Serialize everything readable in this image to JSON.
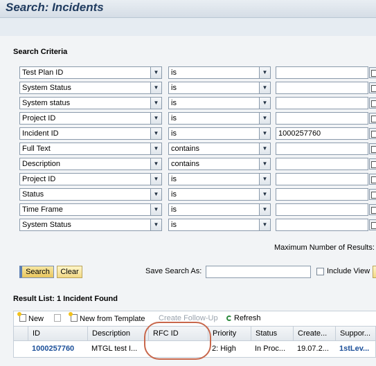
{
  "title": "Search: Incidents",
  "search_criteria": {
    "heading": "Search Criteria",
    "rows": [
      {
        "field": "Test Plan ID",
        "operator": "is",
        "value": ""
      },
      {
        "field": "System Status",
        "operator": "is",
        "value": ""
      },
      {
        "field": "System status",
        "operator": "is",
        "value": ""
      },
      {
        "field": "Project ID",
        "operator": "is",
        "value": ""
      },
      {
        "field": "Incident ID",
        "operator": "is",
        "value": "1000257760"
      },
      {
        "field": "Full Text",
        "operator": "contains",
        "value": ""
      },
      {
        "field": "Description",
        "operator": "contains",
        "value": ""
      },
      {
        "field": "Project ID",
        "operator": "is",
        "value": ""
      },
      {
        "field": "Status",
        "operator": "is",
        "value": ""
      },
      {
        "field": "Time Frame",
        "operator": "is",
        "value": ""
      },
      {
        "field": "System Status",
        "operator": "is",
        "value": ""
      }
    ],
    "max_results_label": "Maximum Number of Results:"
  },
  "actions": {
    "search_label": "Search",
    "clear_label": "Clear",
    "save_search_label": "Save Search As:",
    "save_search_value": "",
    "include_view_label": "Include View"
  },
  "results": {
    "heading": "Result List: 1 Incident Found",
    "toolbar": {
      "new_label": "New",
      "new_from_template_label": "New from Template",
      "create_follow_up_label": "Create Follow-Up",
      "refresh_label": "Refresh"
    },
    "columns": [
      "ID",
      "Description",
      "RFC ID",
      "Priority",
      "Status",
      "Create...",
      "Suppor..."
    ],
    "rows": [
      {
        "id": "1000257760",
        "description": "MTGL test I...",
        "rfc_id": "",
        "priority": "2: High",
        "status": "In Proc...",
        "created": "19.07.2...",
        "support": "1stLev..."
      }
    ]
  }
}
